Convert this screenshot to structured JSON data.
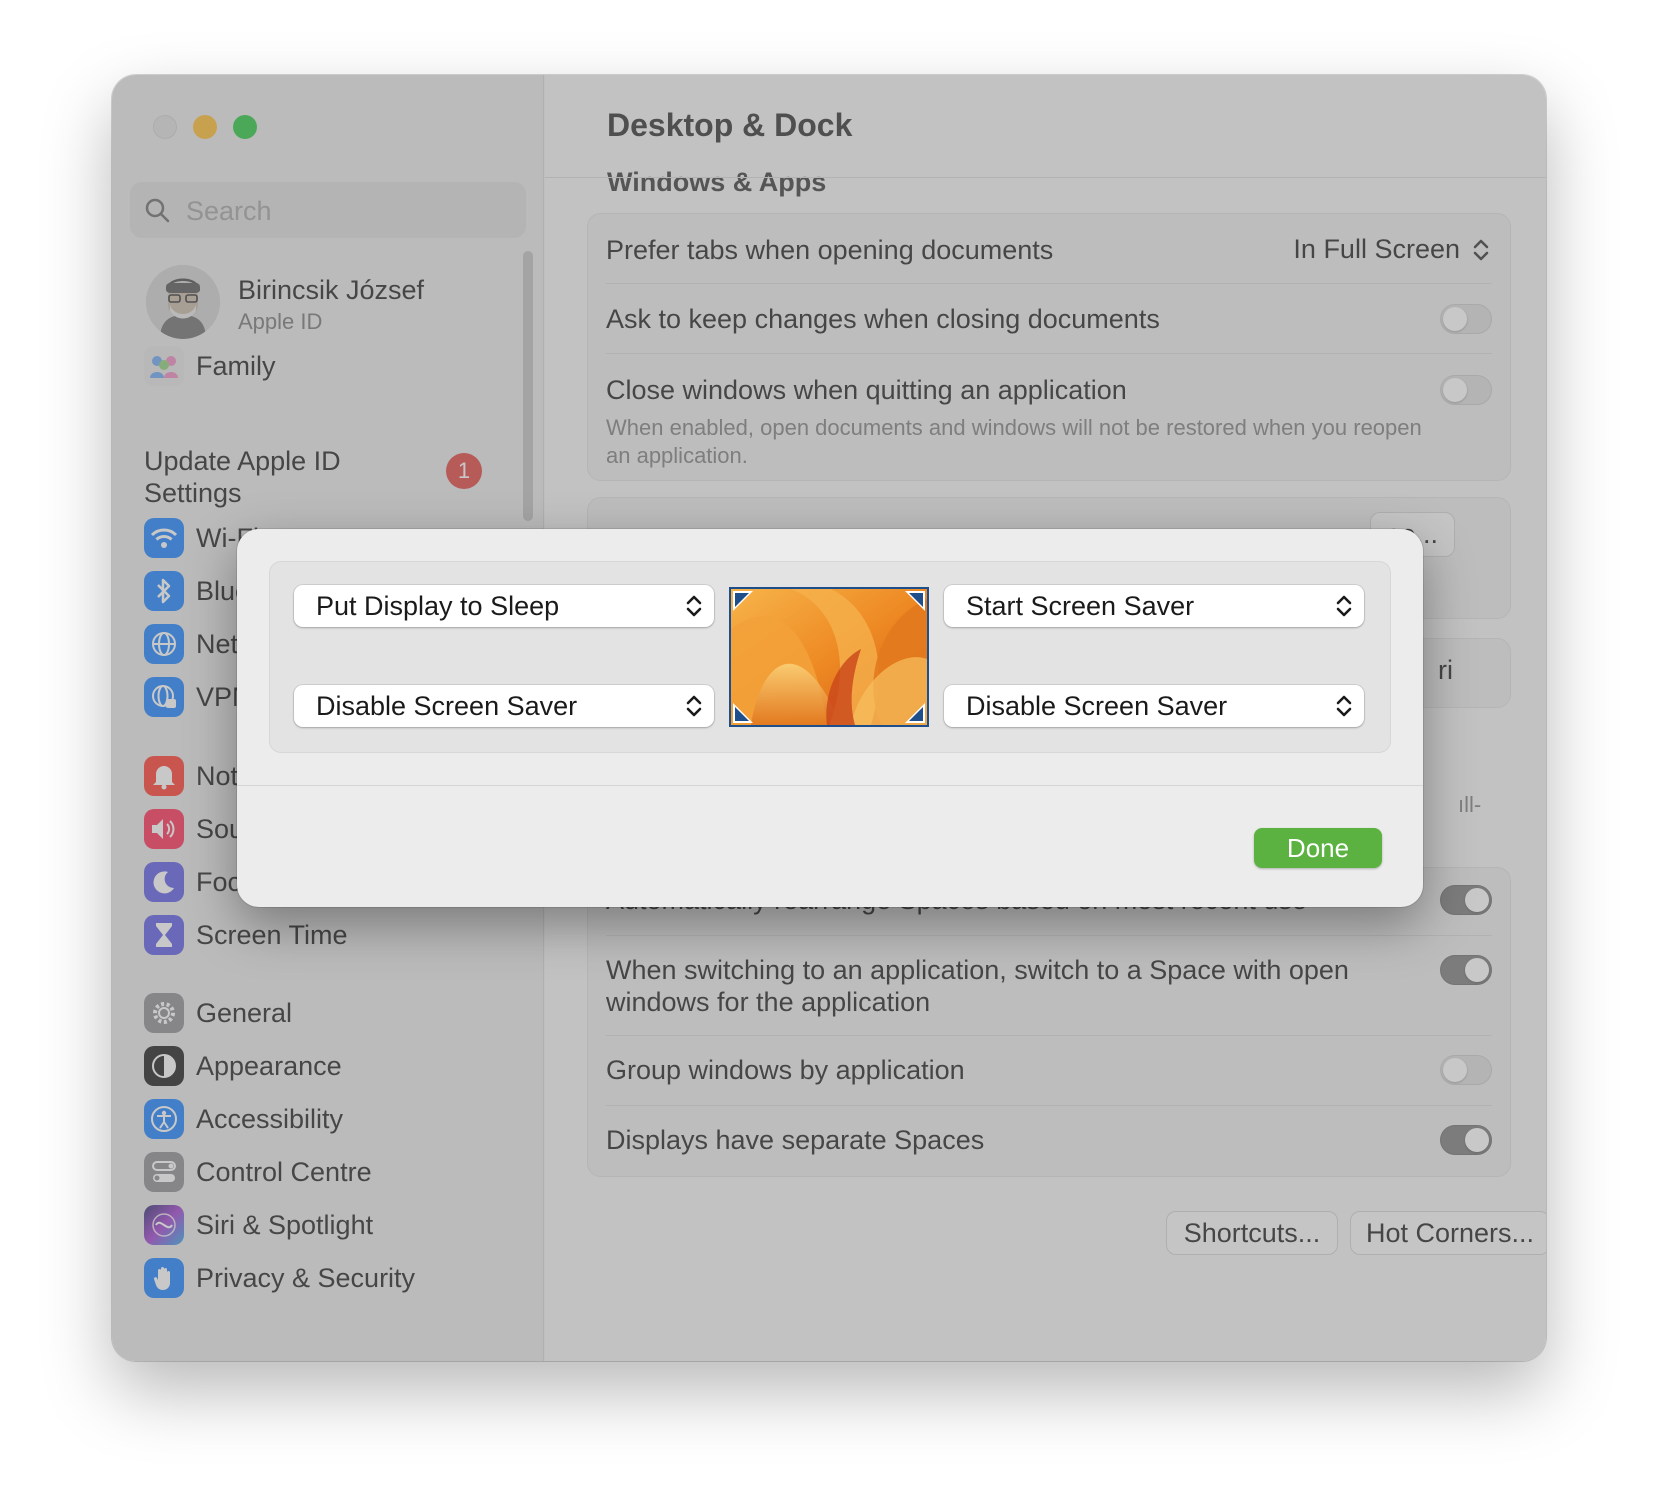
{
  "window": {
    "title": "Desktop & Dock"
  },
  "sidebar": {
    "search_placeholder": "Search",
    "profile": {
      "name": "Birincsik József",
      "subtitle": "Apple ID"
    },
    "family_label": "Family",
    "update_label": "Update Apple ID Settings",
    "update_badge": "1",
    "items": [
      {
        "label": "Wi-Fi",
        "icon": "wifi-icon",
        "color": "#1a82ff"
      },
      {
        "label": "Bluetooth",
        "icon": "bluetooth-icon",
        "color": "#1a82ff"
      },
      {
        "label": "Network",
        "icon": "globe-icon",
        "color": "#1a82ff"
      },
      {
        "label": "VPN",
        "icon": "vpn-globe-icon",
        "color": "#1a82ff"
      },
      {
        "label": "Notifications",
        "icon": "bell-icon",
        "color": "#ff3b30"
      },
      {
        "label": "Sound",
        "icon": "speaker-icon",
        "color": "#ff2d55"
      },
      {
        "label": "Focus",
        "icon": "moon-icon",
        "color": "#5e5ce6"
      },
      {
        "label": "Screen Time",
        "icon": "hourglass-icon",
        "color": "#5e5ce6"
      },
      {
        "label": "General",
        "icon": "gear-icon",
        "color": "#8e8e93"
      },
      {
        "label": "Appearance",
        "icon": "appearance-icon",
        "color": "#1c1c1e"
      },
      {
        "label": "Accessibility",
        "icon": "accessibility-icon",
        "color": "#1a82ff"
      },
      {
        "label": "Control Centre",
        "icon": "control-centre-icon",
        "color": "#8e8e93"
      },
      {
        "label": "Siri & Spotlight",
        "icon": "siri-icon",
        "color": "#7a3fd1"
      },
      {
        "label": "Privacy & Security",
        "icon": "hand-icon",
        "color": "#1a82ff"
      }
    ]
  },
  "main": {
    "section_title": "Windows & Apps",
    "rows": {
      "prefer_tabs": {
        "label": "Prefer tabs when opening documents",
        "value": "In Full Screen"
      },
      "ask_keep": {
        "label": "Ask to keep changes when closing documents",
        "on": false
      },
      "close_windows": {
        "label": "Close windows when quitting an application",
        "description": "When enabled, open documents and windows will not be restored when you reopen an application.",
        "on": false
      },
      "rearrange_spaces": {
        "label": "Automatically rearrange Spaces based on most recent use",
        "on": true
      },
      "switch_space": {
        "label": "When switching to an application, switch to a Space with open windows for the application",
        "on": true
      },
      "group_windows": {
        "label": "Group windows by application",
        "on": false
      },
      "separate_spaces": {
        "label": "Displays have separate Spaces",
        "on": true
      }
    },
    "partial_button": "se...",
    "partial_popup": "ri",
    "partial_text": "ıll-",
    "buttons": {
      "shortcuts": "Shortcuts...",
      "hot_corners": "Hot Corners...",
      "help": "?"
    }
  },
  "sheet": {
    "top_left": "Put Display to Sleep",
    "top_right": "Start Screen Saver",
    "bottom_left": "Disable Screen Saver",
    "bottom_right": "Disable Screen Saver",
    "done_label": "Done"
  }
}
